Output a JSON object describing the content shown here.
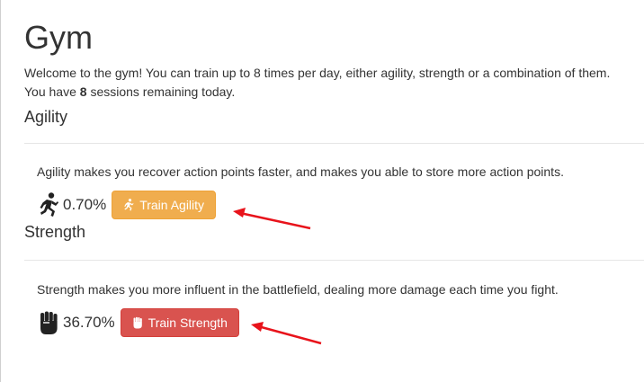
{
  "page": {
    "title": "Gym",
    "intro_line1": "Welcome to the gym! You can train up to 8 times per day, either agility, strength or a combination of them.",
    "intro_line2_prefix": "You have ",
    "intro_sessions": "8",
    "intro_line2_suffix": " sessions remaining today."
  },
  "agility": {
    "title": "Agility",
    "description": "Agility makes you recover action points faster, and makes you able to store more action points.",
    "icon": "running-icon",
    "value": "0.70%",
    "button_label": "Train Agility",
    "button_color": "#f0ad4e"
  },
  "strength": {
    "title": "Strength",
    "description": "Strength makes you more influent in the battlefield, dealing more damage each time you fight.",
    "icon": "fist-icon",
    "value": "36.70%",
    "button_label": "Train Strength",
    "button_color": "#d9534f"
  },
  "annotations": {
    "arrow_color": "#e8131b"
  }
}
